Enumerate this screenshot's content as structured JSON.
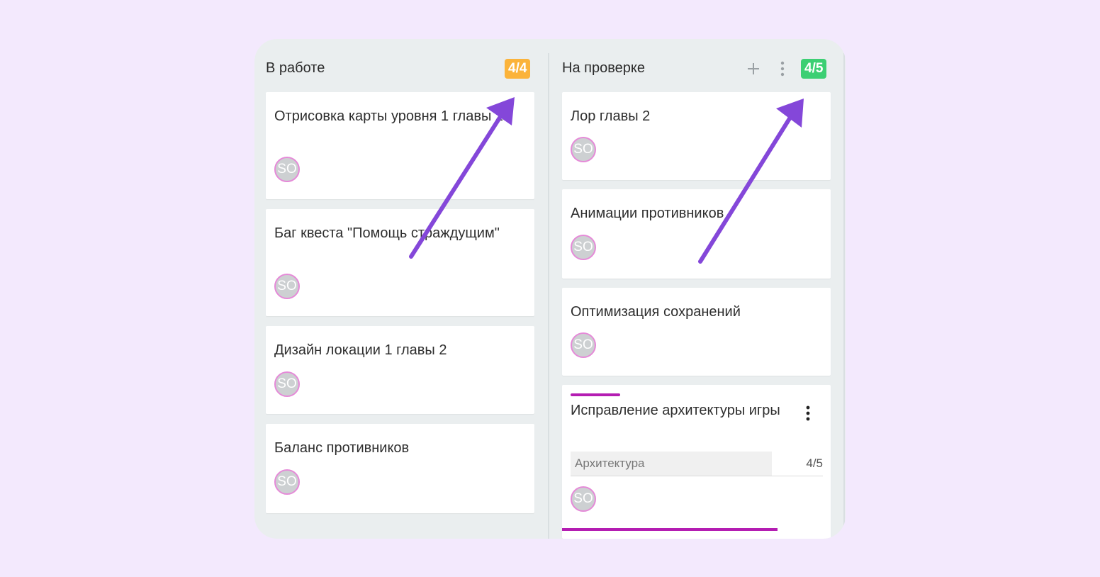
{
  "columns": [
    {
      "title": "В работе",
      "badge": "4/4",
      "badge_color": "#fbb33a",
      "cards": [
        {
          "title": "Отрисовка карты уровня 1 главы 2",
          "avatar": "SO"
        },
        {
          "title": "Баг квеста \"Помощь страждущим\"",
          "avatar": "SO"
        },
        {
          "title": "Дизайн локации 1 главы 2",
          "avatar": "SO"
        },
        {
          "title": "Баланс противников",
          "avatar": "SO"
        }
      ]
    },
    {
      "title": "На проверке",
      "badge": "4/5",
      "badge_color": "#3ccf73",
      "actions": {
        "add_icon": "plus-icon",
        "menu_icon": "vertical-dots-icon"
      },
      "cards": [
        {
          "title": "Лор главы 2",
          "avatar": "SO"
        },
        {
          "title": "Анимации противников",
          "avatar": "SO"
        },
        {
          "title": "Оптимизация сохранений",
          "avatar": "SO"
        },
        {
          "title": "Исправление архитектуры игры",
          "avatar": "SO",
          "tag": "Архитектура",
          "tag_count": "4/5",
          "accent_color": "#b41db2"
        }
      ]
    }
  ],
  "annotation_color": "#8447d9"
}
